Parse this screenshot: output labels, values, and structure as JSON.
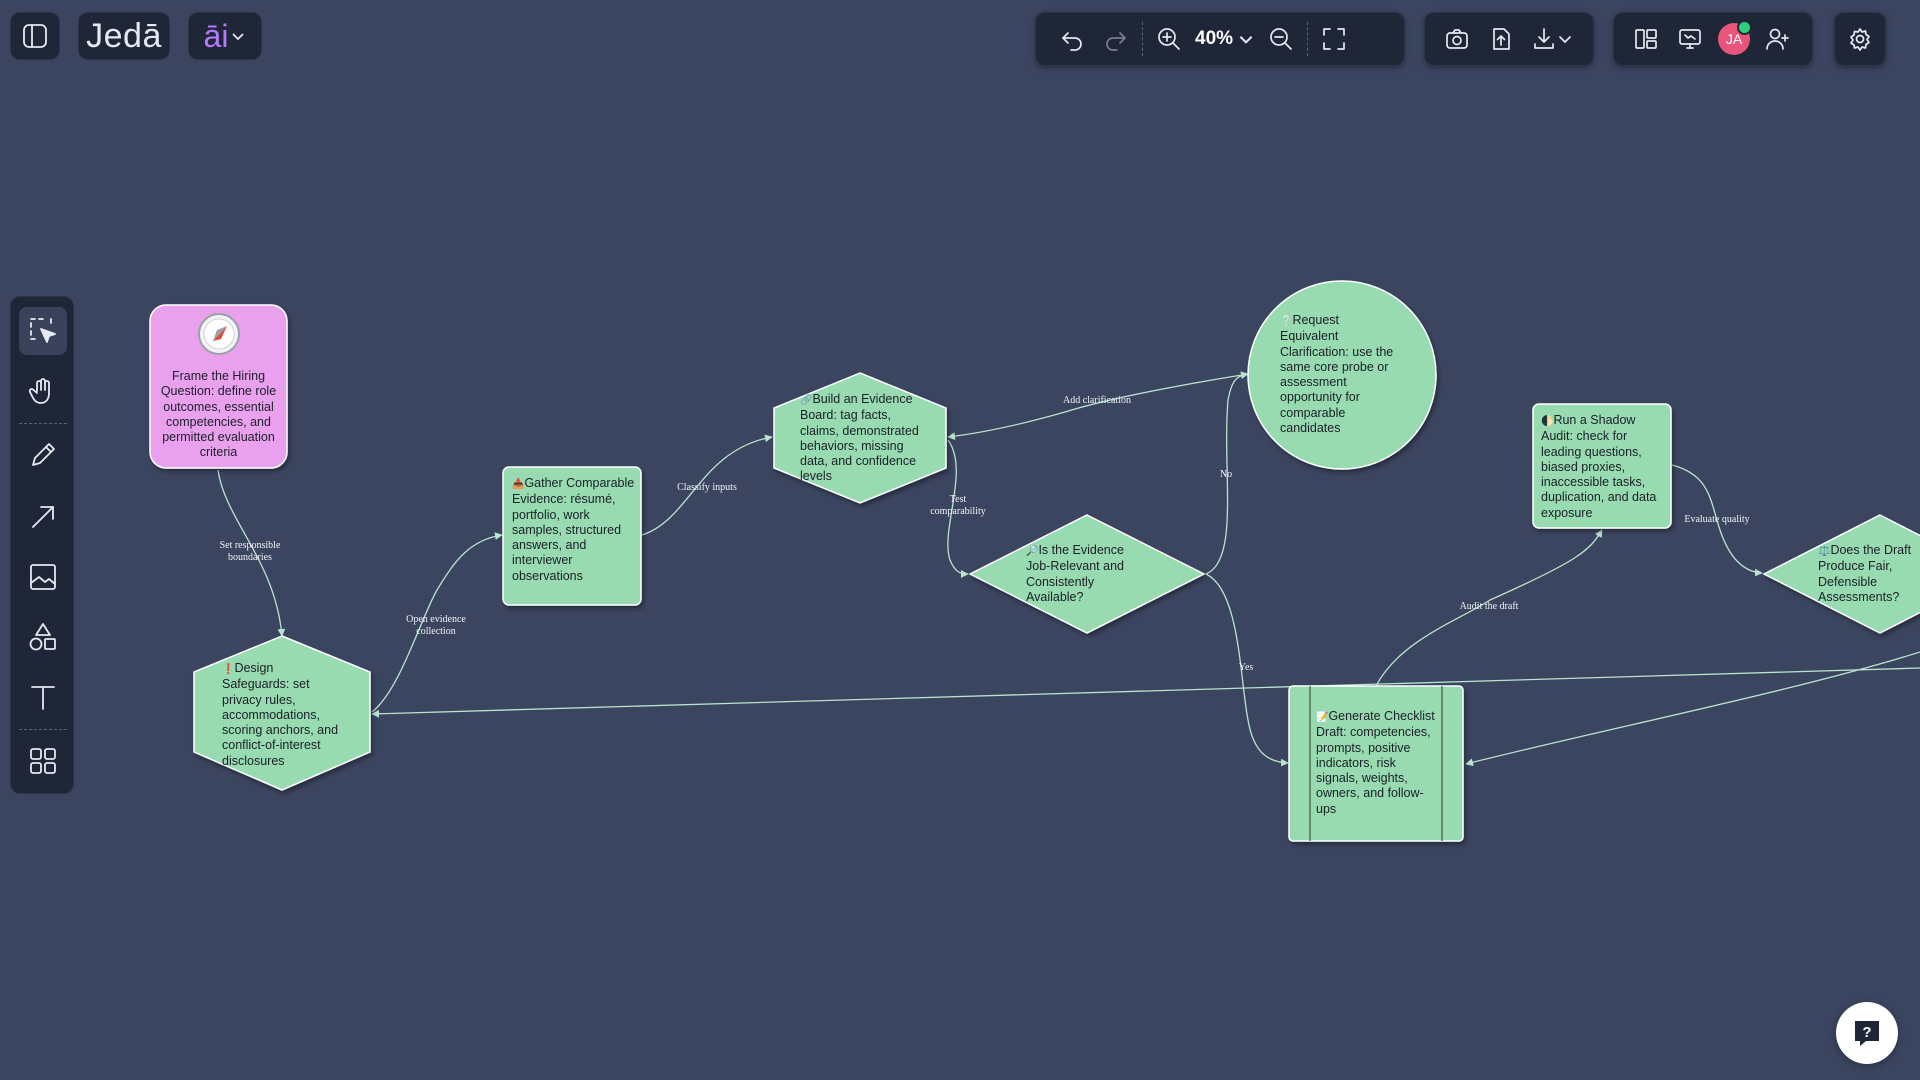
{
  "app": {
    "logo_text": "Jedā",
    "ai_text": "āi",
    "zoom_label": "40%",
    "avatar_initials": "JA",
    "colors": {
      "canvas": "#3b4560",
      "toolbar": "#1f2638",
      "node_green": "#98dbb0",
      "node_pink": "#e9a1ee",
      "avatar": "#e8557a",
      "accent_purple": "#b57bff",
      "edge": "#b9e3cf"
    }
  },
  "toolbar": {
    "icons": [
      "sidebar-toggle-icon",
      "undo-icon",
      "redo-icon",
      "zoom-in-icon",
      "chevron-down-icon",
      "zoom-out-icon",
      "fit-screen-icon",
      "camera-icon",
      "upload-icon",
      "download-icon",
      "layout-icon",
      "present-icon",
      "add-user-icon",
      "settings-icon"
    ]
  },
  "tools": [
    "select-tool",
    "hand-tool",
    "pen-tool",
    "arrow-tool",
    "image-tool",
    "shapes-tool",
    "text-tool",
    "templates-tool"
  ],
  "nodes": {
    "frame": {
      "icon": "🧭",
      "text": "Frame the Hiring Question: define role outcomes, essential competencies, and permitted evaluation criteria"
    },
    "safeguards": {
      "icon": "❗",
      "text": "Design Safeguards: set privacy rules, accommodations, scoring anchors, and conflict-of-interest disclosures"
    },
    "gather": {
      "icon": "📥",
      "text": "Gather Comparable Evidence: résumé, portfolio, work samples, structured answers, and interviewer observations"
    },
    "board": {
      "icon": "🔗",
      "text": "Build an Evidence Board: tag facts, claims, demonstrated behaviors, missing data, and confidence levels"
    },
    "decision": {
      "icon": "🔎",
      "text": "Is the Evidence Job-Relevant and Consistently Available?"
    },
    "clarify": {
      "icon": "❔",
      "text": "Request Equivalent Clarification: use the same core probe or assessment opportunity for comparable candidates"
    },
    "checklist": {
      "icon": "📝",
      "text": "Generate Checklist Draft: competencies, prompts, positive indicators, risk signals, weights, owners, and follow-ups"
    },
    "audit": {
      "icon": "🌓",
      "text": "Run a Shadow Audit: check for leading questions, biased proxies, inaccessible tasks, duplication, and data exposure"
    },
    "fair": {
      "icon": "⚖️",
      "text": "Does the Draft Produce Fair, Defensible Assessments?"
    }
  },
  "edges": {
    "set_boundaries": "Set responsible boundaries",
    "open_evidence": "Open evidence collection",
    "classify": "Classify inputs",
    "test_comparability": "Test comparability",
    "add_clarification": "Add clarification",
    "no": "No",
    "yes": "Yes",
    "audit_draft": "Audit the draft",
    "evaluate_quality": "Evaluate quality"
  }
}
